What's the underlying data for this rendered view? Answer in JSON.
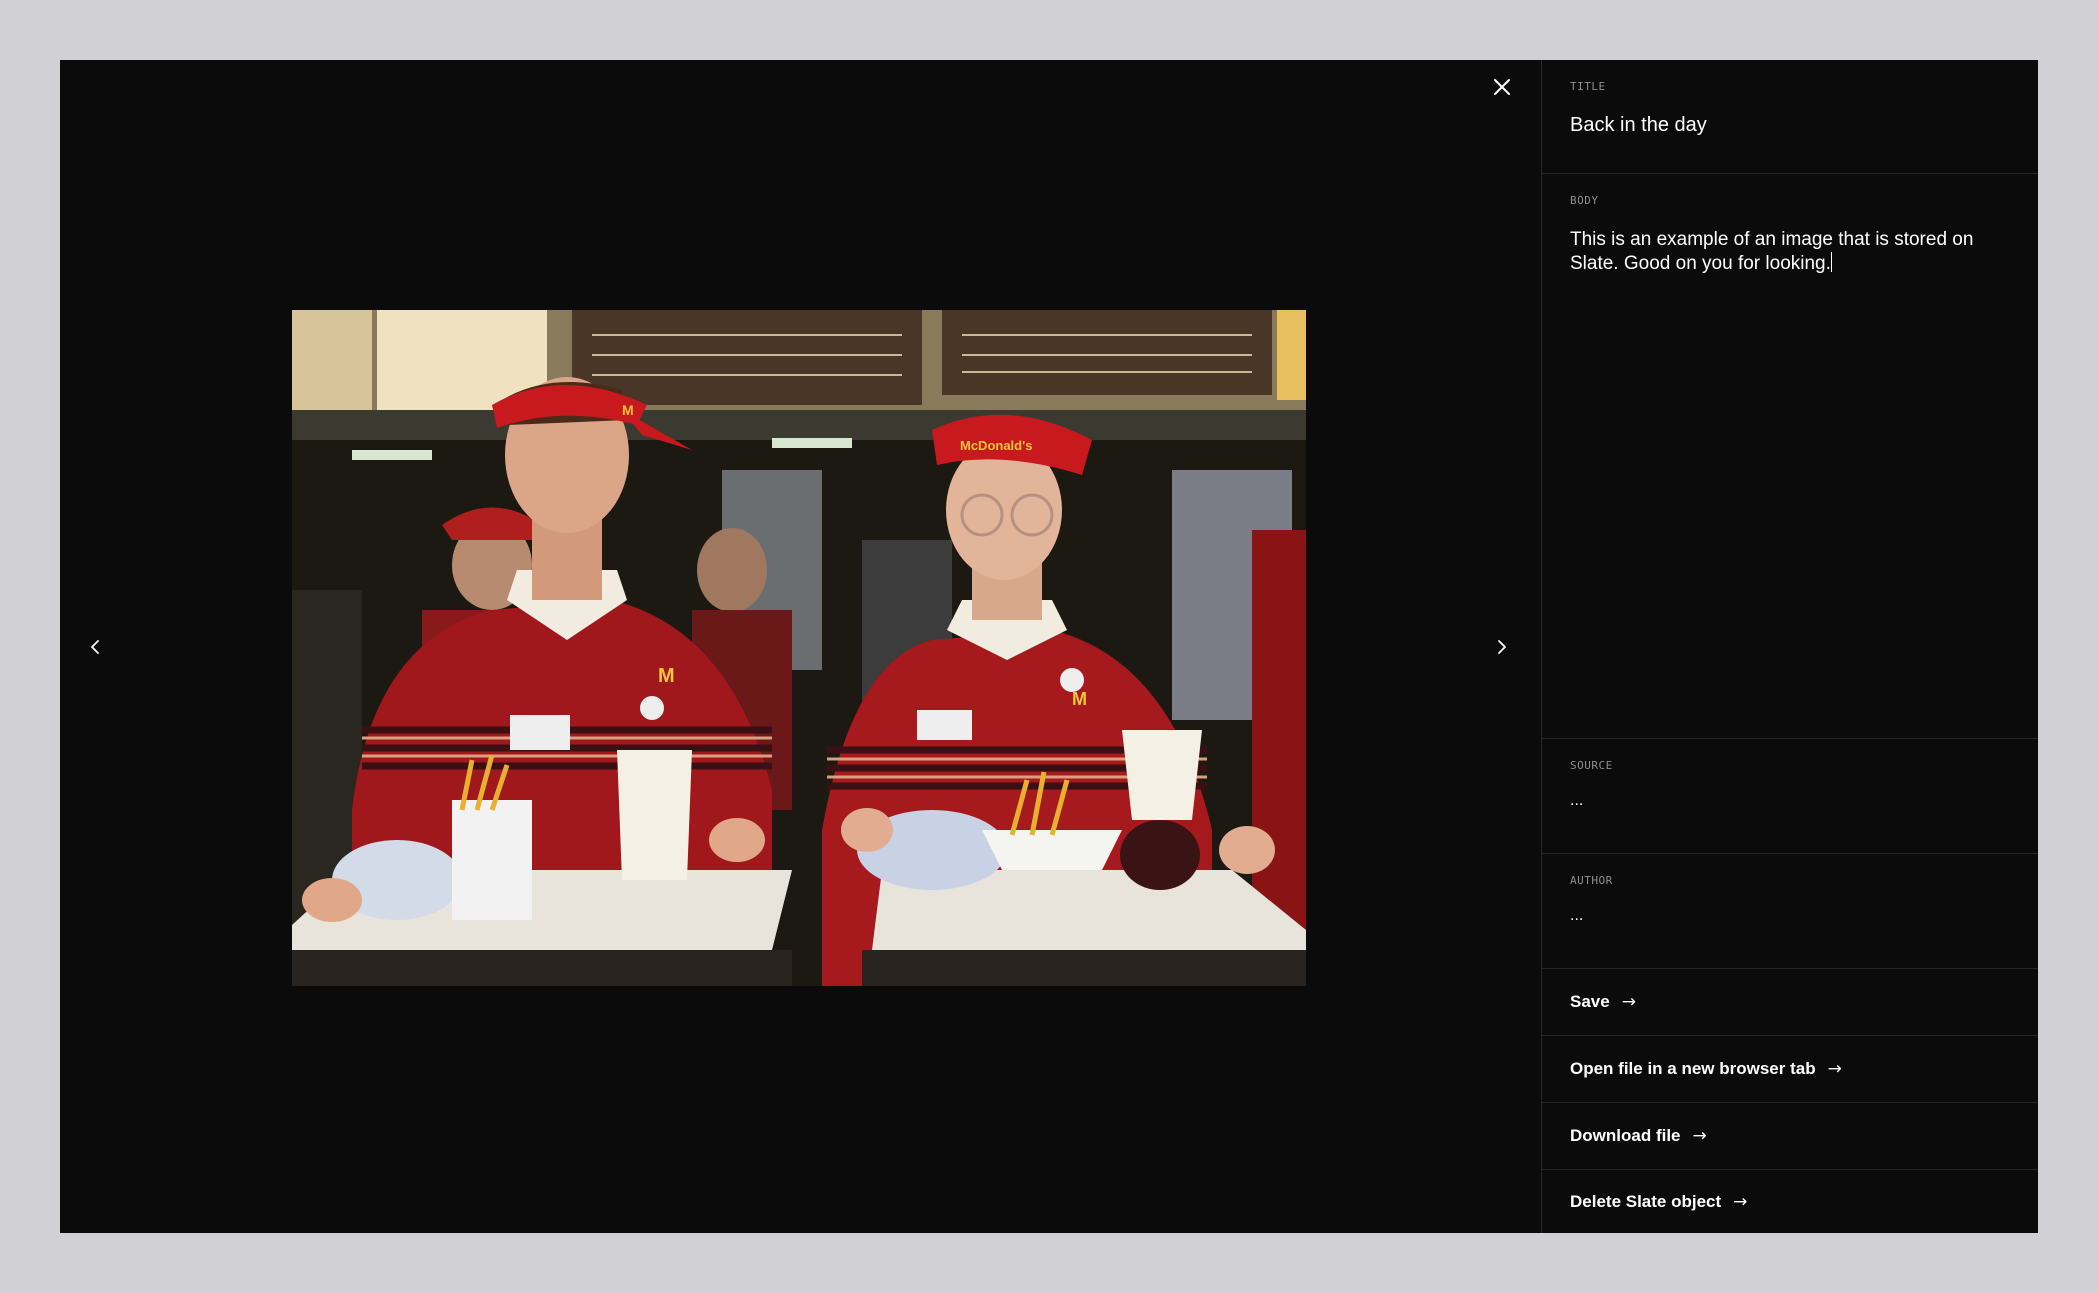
{
  "nav": {
    "close_icon": "close-icon",
    "prev_icon": "chevron-left-icon",
    "next_icon": "chevron-right-icon"
  },
  "image": {
    "alt": "Two McDonald's employees in red uniforms and visors holding trays with fries and drinks"
  },
  "fields": {
    "title": {
      "label": "TITLE",
      "value": "Back in the day"
    },
    "body": {
      "label": "BODY",
      "value": "This is an example of an image that is stored on Slate. Good on you for looking."
    },
    "source": {
      "label": "SOURCE",
      "value": "..."
    },
    "author": {
      "label": "AUTHOR",
      "value": "..."
    }
  },
  "actions": {
    "save": "Save",
    "open_tab": "Open file in a new browser tab",
    "download": "Download file",
    "delete": "Delete Slate object",
    "arrow": "→"
  },
  "colors": {
    "backdrop": "#d1d0d5",
    "modal": "#0b0b0b",
    "text": "#ffffff",
    "label": "#8f8f8f"
  }
}
